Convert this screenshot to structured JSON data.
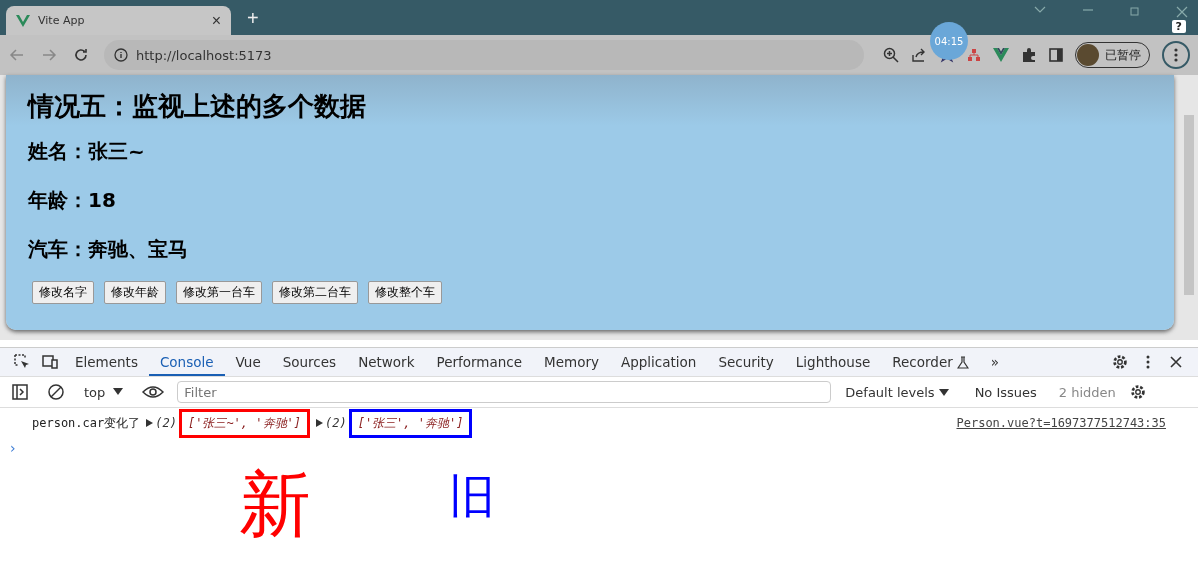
{
  "browser": {
    "tab": {
      "title": "Vite App",
      "close": "×"
    },
    "new_tab": "+",
    "url": "http://localhost:5173",
    "timer": "04:15",
    "help": "?",
    "profile": {
      "status": "已暂停"
    }
  },
  "page": {
    "heading": "情况五：监视上述的多个数据",
    "fields": [
      "姓名：张三~",
      "年龄：18",
      "汽车：奔驰、宝马"
    ],
    "buttons": [
      "修改名字",
      "修改年龄",
      "修改第一台车",
      "修改第二台车",
      "修改整个车"
    ]
  },
  "devtools": {
    "tabs": [
      {
        "label": "Elements",
        "selected": false
      },
      {
        "label": "Console",
        "selected": true
      },
      {
        "label": "Vue",
        "selected": false
      },
      {
        "label": "Sources",
        "selected": false
      },
      {
        "label": "Network",
        "selected": false
      },
      {
        "label": "Performance",
        "selected": false
      },
      {
        "label": "Memory",
        "selected": false
      },
      {
        "label": "Application",
        "selected": false
      },
      {
        "label": "Security",
        "selected": false
      },
      {
        "label": "Lighthouse",
        "selected": false
      },
      {
        "label": "Recorder",
        "selected": false
      }
    ],
    "more": "»",
    "context": "top",
    "filter": {
      "placeholder": "Filter"
    },
    "levels": "Default levels",
    "issues": "No Issues",
    "hidden": "2 hidden",
    "logs": [
      {
        "message": "person.car变化了",
        "args": [
          {
            "count": "(2)",
            "value": "['张三~', '奔驰']",
            "color": "#ff0000"
          },
          {
            "count": "(2)",
            "value": "['张三', '奔驰']",
            "color": "#0000ff"
          }
        ],
        "source": "Person.vue?t=1697377512743:35"
      }
    ],
    "prompt": "›"
  },
  "annotations": [
    {
      "text": "新",
      "color": "#ff0000"
    },
    {
      "text": "旧",
      "color": "#0000ff"
    }
  ]
}
